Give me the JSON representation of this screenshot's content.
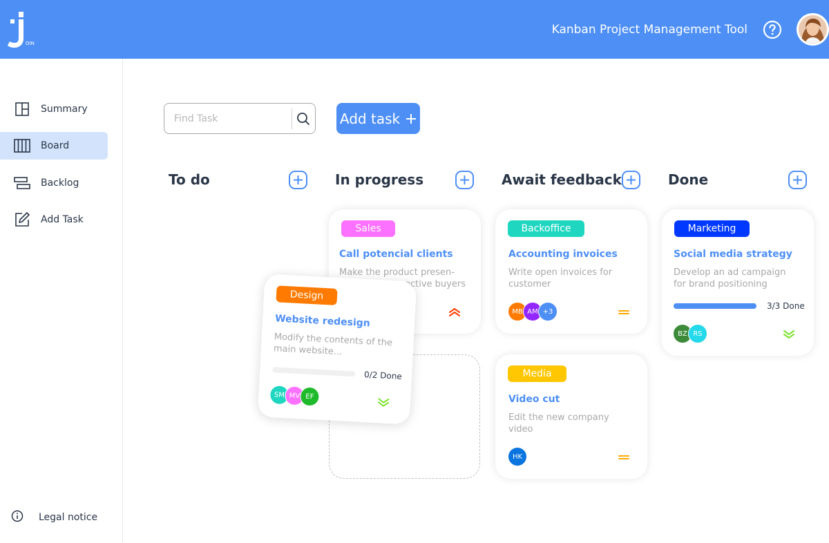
{
  "header": {
    "logo_mark": "J",
    "logo_suffix": "OIN",
    "title": "Kanban Project Management Tool",
    "help_icon": "help-circle-icon",
    "avatar": "user-avatar-photo"
  },
  "sidebar": {
    "items": [
      {
        "label": "Summary",
        "icon": "summary-icon",
        "active": false
      },
      {
        "label": "Board",
        "icon": "board-icon",
        "active": true
      },
      {
        "label": "Backlog",
        "icon": "backlog-icon",
        "active": false
      },
      {
        "label": "Add Task",
        "icon": "add-task-icon",
        "active": false
      }
    ],
    "legal": {
      "label": "Legal notice",
      "icon": "info-icon"
    }
  },
  "toolbar": {
    "search_placeholder": "Find Task",
    "add_task_label": "Add task",
    "add_task_icon": "plus-icon"
  },
  "columns": [
    {
      "title": "To do"
    },
    {
      "title": "In progress"
    },
    {
      "title": "Await feedback"
    },
    {
      "title": "Done"
    }
  ],
  "cards": {
    "sales": {
      "tag": "Sales",
      "tag_color": "#fc71ff",
      "title": "Call potencial clients",
      "desc_line1": "Make the product presen-",
      "desc_line2": "ective buyers",
      "priority": "urgent",
      "priority_color": "#ff3d00"
    },
    "design": {
      "tag": "Design",
      "tag_color": "#ff7a00",
      "title": "Website redesign",
      "desc": "Modify the contents of the main website...",
      "progress_done": 0,
      "progress_total": 2,
      "progress_text": "0/2 Done",
      "avatars": [
        {
          "initials": "SM",
          "color": "#1fd7c1"
        },
        {
          "initials": "MV",
          "color": "#fc71ff"
        },
        {
          "initials": "EF",
          "color": "#1fba2b"
        }
      ],
      "priority": "low",
      "priority_color": "#7ae229"
    },
    "accounting": {
      "tag": "Backoffice",
      "tag_color": "#1fd7c1",
      "title": "Accounting invoices",
      "desc": "Write open invoices for customer",
      "avatars": [
        {
          "initials": "MB",
          "color": "#ff7a00"
        },
        {
          "initials": "AM",
          "color": "#9327ff"
        },
        {
          "initials": "+3",
          "color": "#4d8ff5"
        }
      ],
      "priority": "medium",
      "priority_color": "#ffa800"
    },
    "media": {
      "tag": "Media",
      "tag_color": "#ffc701",
      "title": "Video cut",
      "desc": "Edit the new company video",
      "avatars": [
        {
          "initials": "HK",
          "color": "#0a75de"
        }
      ],
      "priority": "medium",
      "priority_color": "#ffa800"
    },
    "marketing": {
      "tag": "Marketing",
      "tag_color": "#0038ff",
      "title": "Social media strategy",
      "desc": "Develop an ad campaign for brand positioning",
      "progress_done": 3,
      "progress_total": 3,
      "progress_text": "3/3 Done",
      "avatars": [
        {
          "initials": "BZ",
          "color": "#3c8a3a"
        },
        {
          "initials": "RS",
          "color": "#24d9e9"
        }
      ],
      "priority": "low",
      "priority_color": "#7ae229"
    }
  },
  "colors": {
    "accent": "#4d8ff5",
    "sidebar_active": "#d3e3fc",
    "text_dark": "#2a3647"
  }
}
